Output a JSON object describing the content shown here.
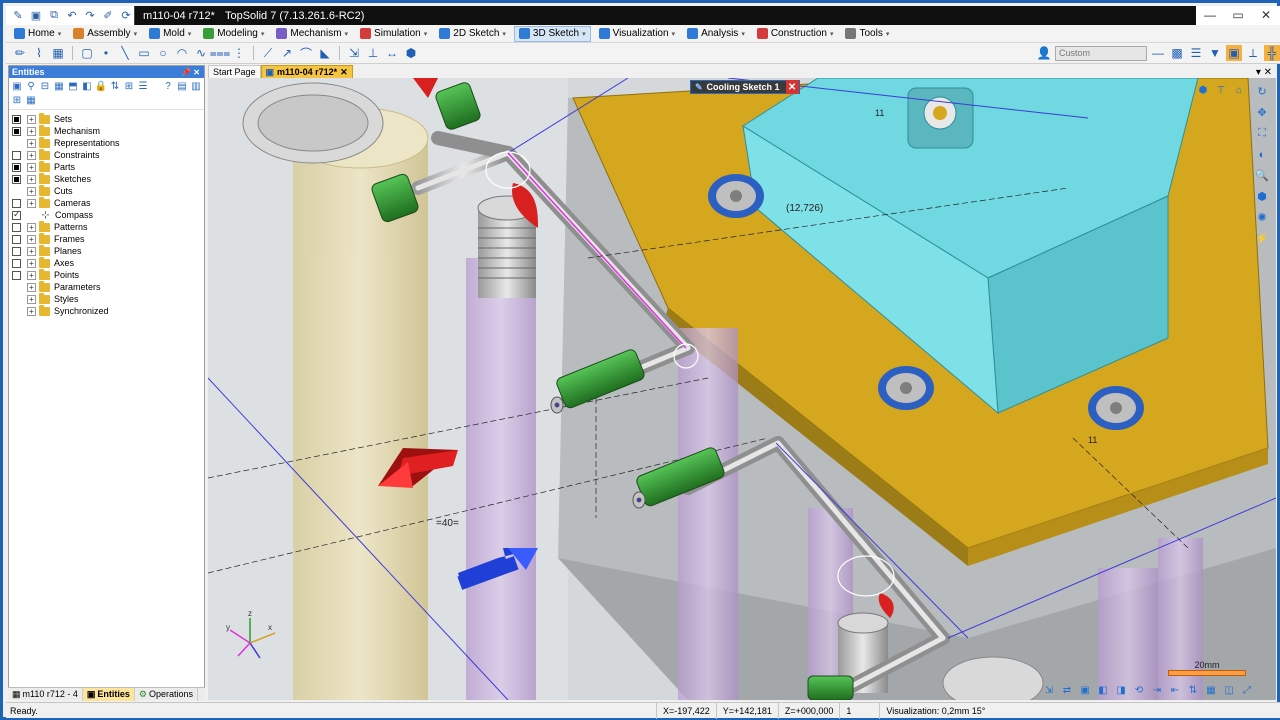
{
  "titlebar": {
    "document_tab": "m110-04 r712*",
    "app_title": "TopSolid 7 (7.13.261.6-RC2)"
  },
  "menubar": {
    "items": [
      {
        "label": "Home",
        "icon": "home-icon",
        "color": "#2f7ad6"
      },
      {
        "label": "Assembly",
        "icon": "assembly-icon",
        "color": "#d9822b"
      },
      {
        "label": "Mold",
        "icon": "mold-icon",
        "color": "#2f7ad6"
      },
      {
        "label": "Modeling",
        "icon": "modeling-icon",
        "color": "#3a9e3a"
      },
      {
        "label": "Mechanism",
        "icon": "mechanism-icon",
        "color": "#7a5cc7"
      },
      {
        "label": "Simulation",
        "icon": "simulation-icon",
        "color": "#d43b3b"
      },
      {
        "label": "2D Sketch",
        "icon": "sketch-2d-icon",
        "color": "#2f7ad6"
      },
      {
        "label": "3D Sketch",
        "icon": "sketch-3d-icon",
        "color": "#2f7ad6",
        "active": true
      },
      {
        "label": "Visualization",
        "icon": "visualization-icon",
        "color": "#2f7ad6"
      },
      {
        "label": "Analysis",
        "icon": "analysis-icon",
        "color": "#2f7ad6"
      },
      {
        "label": "Construction",
        "icon": "construction-icon",
        "color": "#d43b3b"
      },
      {
        "label": "Tools",
        "icon": "tools-icon",
        "color": "#777777"
      }
    ]
  },
  "toolbar": {
    "custom_combo": "Custom"
  },
  "panel": {
    "title": "Entities",
    "help": "?",
    "tree": [
      {
        "label": "Sets",
        "check": "on"
      },
      {
        "label": "Mechanism",
        "check": "on"
      },
      {
        "label": "Representations",
        "check": "none"
      },
      {
        "label": "Constraints",
        "check": "off"
      },
      {
        "label": "Parts",
        "check": "on"
      },
      {
        "label": "Sketches",
        "check": "on"
      },
      {
        "label": "Cuts",
        "check": "none"
      },
      {
        "label": "Cameras",
        "check": "off"
      },
      {
        "label": "Compass",
        "check": "check",
        "compass": true
      },
      {
        "label": "Patterns",
        "check": "off"
      },
      {
        "label": "Frames",
        "check": "off"
      },
      {
        "label": "Planes",
        "check": "off"
      },
      {
        "label": "Axes",
        "check": "off"
      },
      {
        "label": "Points",
        "check": "off"
      },
      {
        "label": "Parameters",
        "check": "none"
      },
      {
        "label": "Styles",
        "check": "none"
      },
      {
        "label": "Synchronized",
        "check": "none"
      }
    ],
    "tabs": {
      "project": "m110 r712 - 4",
      "entities": "Entities",
      "operations": "Operations"
    }
  },
  "document_tabs": {
    "start_page": "Start Page",
    "active": "m110-04 r712*"
  },
  "viewport": {
    "sketch_badge": "Cooling Sketch 1",
    "dim_coordinate": "(12,726)",
    "dim_40": "=40=",
    "label_11_top": "11",
    "label_11_bottom": "11",
    "scale_label": "20mm",
    "colors": {
      "plate": "#d4a71f",
      "insert": "#6fd8e0",
      "cooling_arrow_red": "#e02020",
      "cooling_arrow_blue": "#1f3fd6",
      "fitting": "#2f9a2f"
    }
  },
  "statusbar": {
    "ready": "Ready.",
    "x": "X=-197,422",
    "y": "Y=+142,181",
    "z": "Z=+000,000",
    "count": "1",
    "visualization": "Visualization: 0,2mm 15°"
  }
}
